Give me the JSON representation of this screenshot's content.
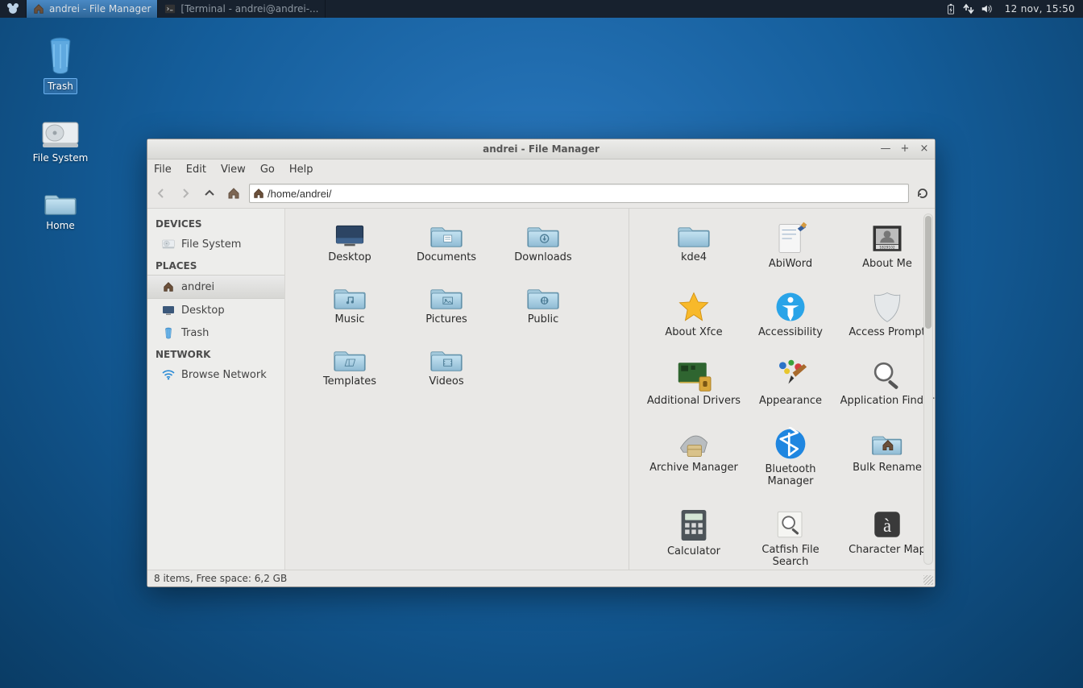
{
  "panel": {
    "task_fm_label": "andrei - File Manager",
    "task_term_label": "[Terminal - andrei@andrei-...",
    "clock": "12 nov, 15:50"
  },
  "desktop": {
    "trash": "Trash",
    "filesystem": "File System",
    "home": "Home"
  },
  "window": {
    "title": "andrei - File Manager",
    "menu": {
      "file": "File",
      "edit": "Edit",
      "view": "View",
      "go": "Go",
      "help": "Help"
    },
    "path": "/home/andrei/",
    "status": "8 items, Free space: 6,2 GB"
  },
  "sidebar": {
    "devices_head": "DEVICES",
    "filesystem": "File System",
    "places_head": "PLACES",
    "user": "andrei",
    "desktop": "Desktop",
    "trash": "Trash",
    "network_head": "NETWORK",
    "browse": "Browse Network"
  },
  "left_items": [
    {
      "label": "Desktop",
      "icon": "desktop"
    },
    {
      "label": "Documents",
      "icon": "folder-doc"
    },
    {
      "label": "Downloads",
      "icon": "folder-down"
    },
    {
      "label": "Music",
      "icon": "folder-music"
    },
    {
      "label": "Pictures",
      "icon": "folder-pic"
    },
    {
      "label": "Public",
      "icon": "folder-pub"
    },
    {
      "label": "Templates",
      "icon": "folder-tpl"
    },
    {
      "label": "Videos",
      "icon": "folder-vid"
    }
  ],
  "right_items": [
    {
      "label": "kde4",
      "icon": "folder"
    },
    {
      "label": "AbiWord",
      "icon": "abiword"
    },
    {
      "label": "About Me",
      "icon": "aboutme"
    },
    {
      "label": "About Xfce",
      "icon": "star"
    },
    {
      "label": "Accessibility",
      "icon": "access"
    },
    {
      "label": "Access Prompt",
      "icon": "shield"
    },
    {
      "label": "Additional Drivers",
      "icon": "drivers"
    },
    {
      "label": "Appearance",
      "icon": "appearance"
    },
    {
      "label": "Application Finder",
      "icon": "magnifier"
    },
    {
      "label": "Archive Manager",
      "icon": "archive"
    },
    {
      "label": "Bluetooth Manager",
      "icon": "bluetooth"
    },
    {
      "label": "Bulk Rename",
      "icon": "bulkrename"
    },
    {
      "label": "Calculator",
      "icon": "calc"
    },
    {
      "label": "Catfish File Search",
      "icon": "catfish"
    },
    {
      "label": "Character Map",
      "icon": "charmap"
    },
    {
      "label": "",
      "icon": "gray"
    },
    {
      "label": "",
      "icon": "doc"
    },
    {
      "label": "",
      "icon": "display"
    }
  ]
}
